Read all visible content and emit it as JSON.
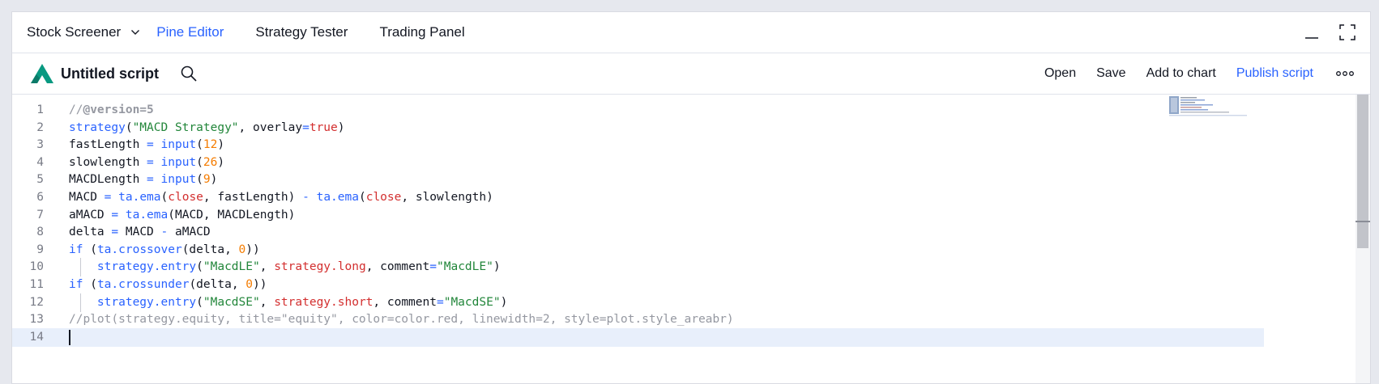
{
  "tabs": {
    "stock_screener": "Stock Screener",
    "pine_editor": "Pine Editor",
    "strategy_tester": "Strategy Tester",
    "trading_panel": "Trading Panel"
  },
  "toolbar": {
    "script_title": "Untitled script",
    "open_label": "Open",
    "save_label": "Save",
    "add_to_chart_label": "Add to chart",
    "publish_label": "Publish script"
  },
  "icons": {
    "dropdown": "chevron-down-icon",
    "minimize": "minimize-icon",
    "maximize": "maximize-icon",
    "logo": "pine-logo-icon",
    "search": "search-icon",
    "more": "more-dots-icon"
  },
  "colors": {
    "accent": "#2962ff",
    "string": "#22863a",
    "number": "#f57c00",
    "builtin_var": "#d32f2f",
    "comment": "#9598a1",
    "current_line": "#e8effb",
    "logo_green": "#089981"
  },
  "code": {
    "lines": [
      {
        "n": "1",
        "tokens": [
          {
            "t": "//",
            "c": "cm"
          },
          {
            "t": "@version=5",
            "c": "cmb"
          }
        ]
      },
      {
        "n": "2",
        "tokens": [
          {
            "t": "strategy",
            "c": "fn"
          },
          {
            "t": "(",
            "c": "pl"
          },
          {
            "t": "\"MACD Strategy\"",
            "c": "str"
          },
          {
            "t": ", overlay",
            "c": "pl"
          },
          {
            "t": "=",
            "c": "op"
          },
          {
            "t": "true",
            "c": "bool"
          },
          {
            "t": ")",
            "c": "pl"
          }
        ]
      },
      {
        "n": "3",
        "tokens": [
          {
            "t": "fastLength ",
            "c": "pl"
          },
          {
            "t": "=",
            "c": "op"
          },
          {
            "t": " ",
            "c": "pl"
          },
          {
            "t": "input",
            "c": "fn"
          },
          {
            "t": "(",
            "c": "pl"
          },
          {
            "t": "12",
            "c": "num"
          },
          {
            "t": ")",
            "c": "pl"
          }
        ]
      },
      {
        "n": "4",
        "tokens": [
          {
            "t": "slowlength ",
            "c": "pl"
          },
          {
            "t": "=",
            "c": "op"
          },
          {
            "t": " ",
            "c": "pl"
          },
          {
            "t": "input",
            "c": "fn"
          },
          {
            "t": "(",
            "c": "pl"
          },
          {
            "t": "26",
            "c": "num"
          },
          {
            "t": ")",
            "c": "pl"
          }
        ]
      },
      {
        "n": "5",
        "tokens": [
          {
            "t": "MACDLength ",
            "c": "pl"
          },
          {
            "t": "=",
            "c": "op"
          },
          {
            "t": " ",
            "c": "pl"
          },
          {
            "t": "input",
            "c": "fn"
          },
          {
            "t": "(",
            "c": "pl"
          },
          {
            "t": "9",
            "c": "num"
          },
          {
            "t": ")",
            "c": "pl"
          }
        ]
      },
      {
        "n": "6",
        "tokens": [
          {
            "t": "MACD ",
            "c": "pl"
          },
          {
            "t": "=",
            "c": "op"
          },
          {
            "t": " ",
            "c": "pl"
          },
          {
            "t": "ta.ema",
            "c": "fn"
          },
          {
            "t": "(",
            "c": "pl"
          },
          {
            "t": "close",
            "c": "var"
          },
          {
            "t": ", fastLength) ",
            "c": "pl"
          },
          {
            "t": "-",
            "c": "op"
          },
          {
            "t": " ",
            "c": "pl"
          },
          {
            "t": "ta.ema",
            "c": "fn"
          },
          {
            "t": "(",
            "c": "pl"
          },
          {
            "t": "close",
            "c": "var"
          },
          {
            "t": ", slowlength)",
            "c": "pl"
          }
        ]
      },
      {
        "n": "7",
        "tokens": [
          {
            "t": "aMACD ",
            "c": "pl"
          },
          {
            "t": "=",
            "c": "op"
          },
          {
            "t": " ",
            "c": "pl"
          },
          {
            "t": "ta.ema",
            "c": "fn"
          },
          {
            "t": "(MACD, MACDLength)",
            "c": "pl"
          }
        ]
      },
      {
        "n": "8",
        "tokens": [
          {
            "t": "delta ",
            "c": "pl"
          },
          {
            "t": "=",
            "c": "op"
          },
          {
            "t": " MACD ",
            "c": "pl"
          },
          {
            "t": "-",
            "c": "op"
          },
          {
            "t": " aMACD",
            "c": "pl"
          }
        ]
      },
      {
        "n": "9",
        "tokens": [
          {
            "t": "if",
            "c": "kw"
          },
          {
            "t": " (",
            "c": "pl"
          },
          {
            "t": "ta.crossover",
            "c": "fn"
          },
          {
            "t": "(delta, ",
            "c": "pl"
          },
          {
            "t": "0",
            "c": "num"
          },
          {
            "t": "))",
            "c": "pl"
          }
        ]
      },
      {
        "n": "10",
        "indent": true,
        "tokens": [
          {
            "t": "    ",
            "c": "pl"
          },
          {
            "t": "strategy.entry",
            "c": "fn"
          },
          {
            "t": "(",
            "c": "pl"
          },
          {
            "t": "\"MacdLE\"",
            "c": "str"
          },
          {
            "t": ", ",
            "c": "pl"
          },
          {
            "t": "strategy.long",
            "c": "var"
          },
          {
            "t": ", comment",
            "c": "pl"
          },
          {
            "t": "=",
            "c": "op"
          },
          {
            "t": "\"MacdLE\"",
            "c": "str"
          },
          {
            "t": ")",
            "c": "pl"
          }
        ]
      },
      {
        "n": "11",
        "tokens": [
          {
            "t": "if",
            "c": "kw"
          },
          {
            "t": " (",
            "c": "pl"
          },
          {
            "t": "ta.crossunder",
            "c": "fn"
          },
          {
            "t": "(delta, ",
            "c": "pl"
          },
          {
            "t": "0",
            "c": "num"
          },
          {
            "t": "))",
            "c": "pl"
          }
        ]
      },
      {
        "n": "12",
        "indent": true,
        "tokens": [
          {
            "t": "    ",
            "c": "pl"
          },
          {
            "t": "strategy.entry",
            "c": "fn"
          },
          {
            "t": "(",
            "c": "pl"
          },
          {
            "t": "\"MacdSE\"",
            "c": "str"
          },
          {
            "t": ", ",
            "c": "pl"
          },
          {
            "t": "strategy.short",
            "c": "var"
          },
          {
            "t": ", comment",
            "c": "pl"
          },
          {
            "t": "=",
            "c": "op"
          },
          {
            "t": "\"MacdSE\"",
            "c": "str"
          },
          {
            "t": ")",
            "c": "pl"
          }
        ]
      },
      {
        "n": "13",
        "tokens": [
          {
            "t": "//plot(strategy.equity, title=\"equity\", color=color.red, linewidth=2, style=plot.style_areabr)",
            "c": "cm"
          }
        ]
      },
      {
        "n": "14",
        "current": true,
        "tokens": []
      }
    ]
  }
}
